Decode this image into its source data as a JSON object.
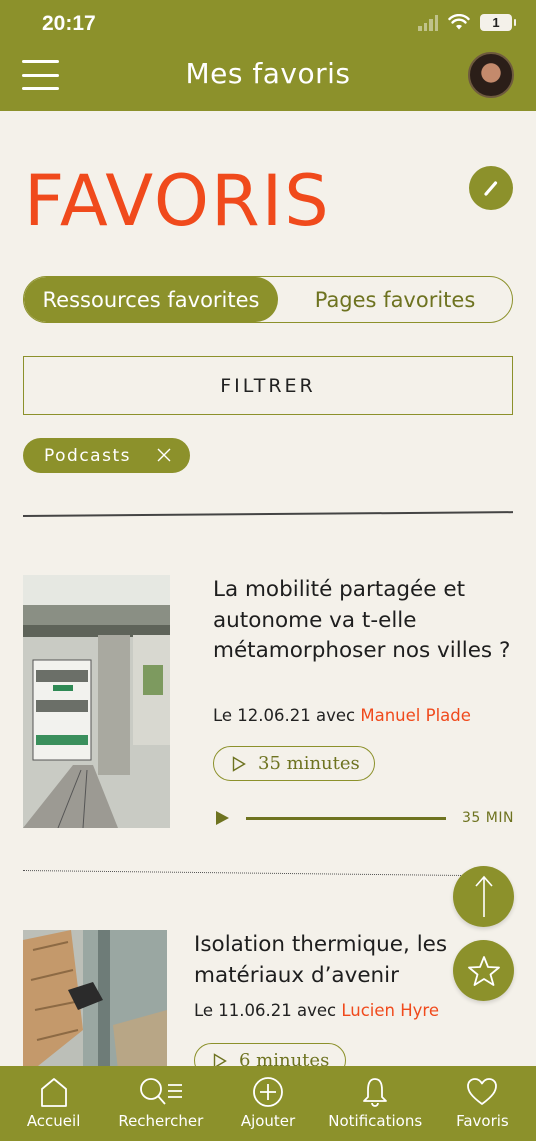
{
  "status_bar": {
    "time": "20:17",
    "battery": "1"
  },
  "header": {
    "title": "Mes favoris"
  },
  "page": {
    "heading": "FAVORIS"
  },
  "tabs": [
    {
      "label": "Ressources favorites",
      "active": true
    },
    {
      "label": "Pages favorites",
      "active": false
    }
  ],
  "filter": {
    "label": "FILTRER"
  },
  "active_filter": {
    "label": "Podcasts"
  },
  "items": [
    {
      "title": "La mobilité partagée et autonome va t-elle métamorphoser nos villes ?",
      "date_prefix": "Le 12.06.21 avec ",
      "author": "Manuel Plade",
      "duration": "35 minutes",
      "player_time": "35 MIN"
    },
    {
      "title": "Isolation thermique, les matériaux d’avenir",
      "date_prefix": "Le 11.06.21 avec ",
      "author": "Lucien Hyre",
      "duration": "6 minutes"
    }
  ],
  "bottom_nav": [
    {
      "label": "Accueil",
      "icon": "home-icon"
    },
    {
      "label": "Rechercher",
      "icon": "search-list-icon"
    },
    {
      "label": "Ajouter",
      "icon": "plus-circle-icon"
    },
    {
      "label": "Notifications",
      "icon": "bell-icon"
    },
    {
      "label": "Favoris",
      "icon": "heart-icon"
    }
  ],
  "colors": {
    "primary": "#8c912b",
    "accent": "#f04a1c",
    "background": "#f4f1ea"
  }
}
